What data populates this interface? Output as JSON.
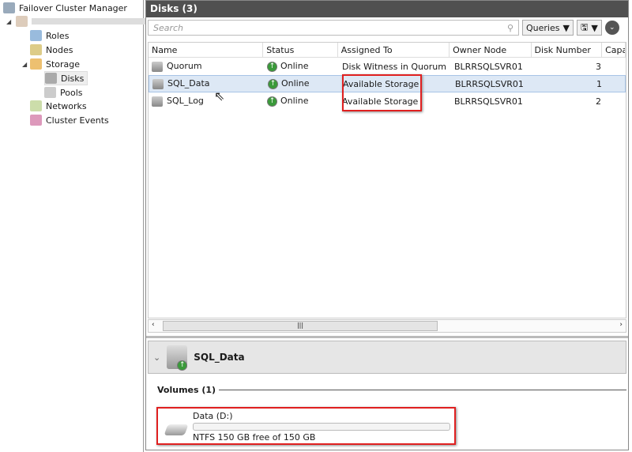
{
  "tree": {
    "root": "Failover Cluster Manager",
    "items": [
      {
        "label": "Roles"
      },
      {
        "label": "Nodes"
      },
      {
        "label": "Storage"
      },
      {
        "label": "Disks"
      },
      {
        "label": "Pools"
      },
      {
        "label": "Networks"
      },
      {
        "label": "Cluster Events"
      }
    ]
  },
  "pane": {
    "title": "Disks (3)",
    "search_placeholder": "Search",
    "queries_label": "Queries"
  },
  "columns": [
    "Name",
    "Status",
    "Assigned To",
    "Owner Node",
    "Disk Number",
    "Capa"
  ],
  "rows": [
    {
      "name": "Quorum",
      "status": "Online",
      "assigned": "Disk Witness in Quorum",
      "owner": "BLRRSQLSVR01",
      "disk": "3"
    },
    {
      "name": "SQL_Data",
      "status": "Online",
      "assigned": "Available Storage",
      "owner": "BLRRSQLSVR01",
      "disk": "1"
    },
    {
      "name": "SQL_Log",
      "status": "Online",
      "assigned": "Available Storage",
      "owner": "BLRRSQLSVR01",
      "disk": "2"
    }
  ],
  "detail": {
    "title": "SQL_Data",
    "volumes_label": "Volumes (1)",
    "volume_name": "Data (D:)",
    "volume_info": "NTFS 150 GB free of 150 GB",
    "used_fraction": 0
  },
  "colors": {
    "highlight": "#e02020",
    "titlebar": "#505050"
  }
}
